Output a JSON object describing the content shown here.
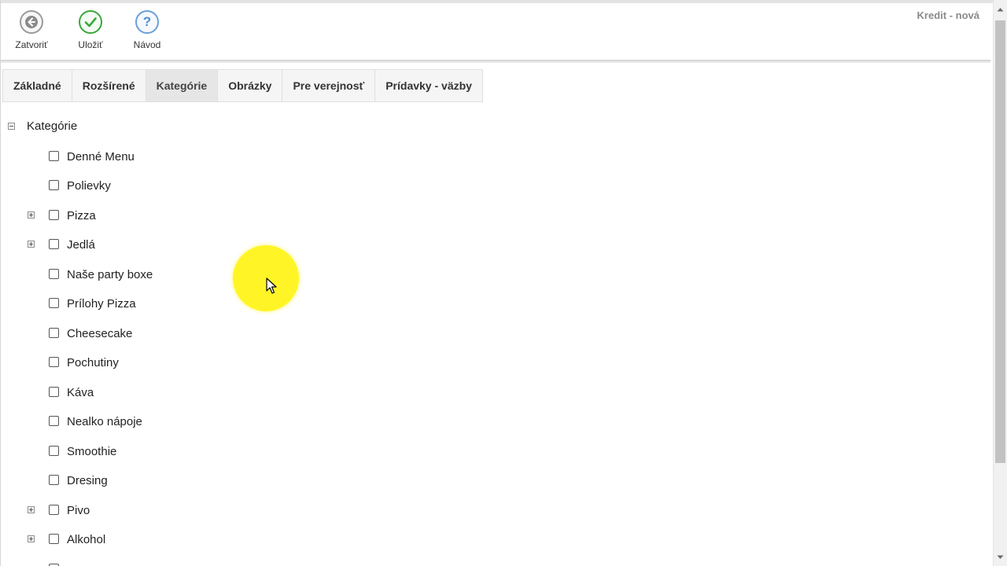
{
  "window": {
    "title": "Kredit - nová"
  },
  "toolbar": {
    "close_label": "Zatvoriť",
    "save_label": "Uložiť",
    "help_label": "Návod",
    "help_glyph": "?"
  },
  "tabs": [
    {
      "label": "Základné"
    },
    {
      "label": "Rozšírené"
    },
    {
      "label": "Kategórie",
      "active": true
    },
    {
      "label": "Obrázky"
    },
    {
      "label": "Pre verejnosť"
    },
    {
      "label": "Prídavky - väzby"
    }
  ],
  "tree": {
    "root_label": "Kategórie",
    "items": [
      {
        "label": "Denné Menu",
        "expandable": false,
        "checked": false
      },
      {
        "label": "Polievky",
        "expandable": false,
        "checked": false
      },
      {
        "label": "Pizza",
        "expandable": true,
        "checked": false
      },
      {
        "label": "Jedlá",
        "expandable": true,
        "checked": false
      },
      {
        "label": "Naše party boxe",
        "expandable": false,
        "checked": false
      },
      {
        "label": "Prílohy Pizza",
        "expandable": false,
        "checked": false
      },
      {
        "label": "Cheesecake",
        "expandable": false,
        "checked": false
      },
      {
        "label": "Pochutiny",
        "expandable": false,
        "checked": false
      },
      {
        "label": "Káva",
        "expandable": false,
        "checked": false
      },
      {
        "label": "Nealko nápoje",
        "expandable": false,
        "checked": false
      },
      {
        "label": "Smoothie",
        "expandable": false,
        "checked": false
      },
      {
        "label": "Dresing",
        "expandable": false,
        "checked": false
      },
      {
        "label": "Pivo",
        "expandable": true,
        "checked": false
      },
      {
        "label": "Alkohol",
        "expandable": true,
        "checked": false
      }
    ]
  },
  "colors": {
    "highlight": "#fff300",
    "save_icon": "#3aa83a",
    "help_icon": "#6aa0d8"
  }
}
